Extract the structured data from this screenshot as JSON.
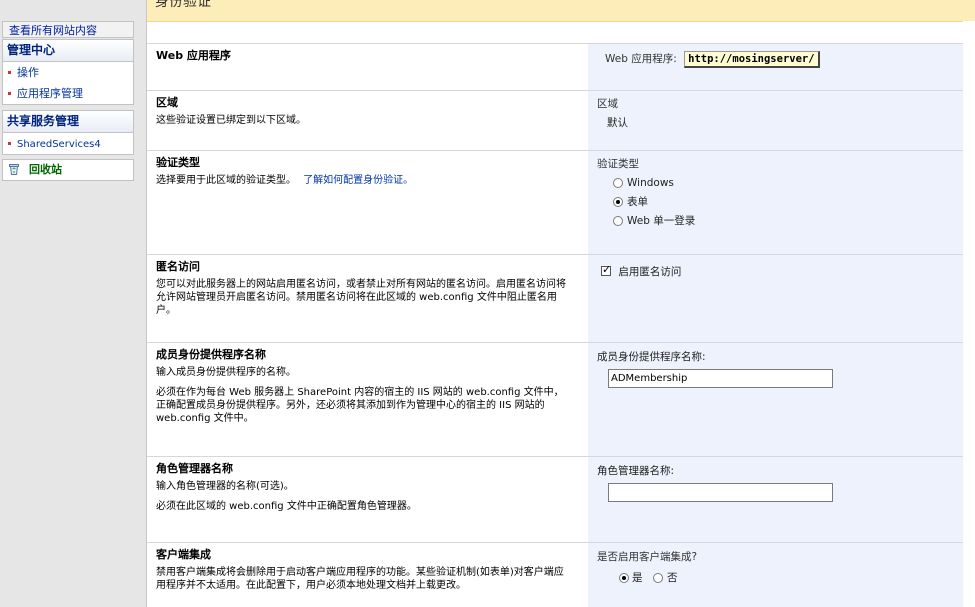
{
  "leftnav": {
    "view_all": "查看所有网站内容",
    "central_admin": {
      "heading": "管理中心",
      "items": [
        {
          "label": "操作"
        },
        {
          "label": "应用程序管理"
        }
      ]
    },
    "ssp": {
      "heading": "共享服务管理",
      "items": [
        {
          "label": "SharedServices4"
        }
      ]
    },
    "recycle_bin": "回收站"
  },
  "header": {
    "title_fragment": "身份验证"
  },
  "sections": {
    "web_app": {
      "title": "Web 应用程序",
      "control_label": "Web 应用程序:",
      "url": "http://mosingserver/"
    },
    "zone": {
      "title": "区域",
      "desc": "这些验证设置已绑定到以下区域。",
      "control_label": "区域",
      "value": "默认"
    },
    "auth_type": {
      "title": "验证类型",
      "desc": "选择要用于此区域的验证类型。",
      "link": "了解如何配置身份验证。",
      "control_label": "验证类型",
      "options": [
        {
          "label": "Windows",
          "selected": false
        },
        {
          "label": "表单",
          "selected": true
        },
        {
          "label": "Web 单一登录",
          "selected": false
        }
      ]
    },
    "anonymous": {
      "title": "匿名访问",
      "desc1": "您可以对此服务器上的网站启用匿名访问，或者禁止对所有网站的匿名访问。启用匿名访问将允许网站管理员开启匿名访问。禁用匿名访问将在此区域的 web.config 文件中阻止匿名用户。",
      "checkbox_label": "启用匿名访问",
      "checked": true
    },
    "membership": {
      "title": "成员身份提供程序名称",
      "desc1": "输入成员身份提供程序的名称。",
      "desc2": "必须在作为每台 Web 服务器上 SharePoint 内容的宿主的 IIS 网站的 web.config 文件中，正确配置成员身份提供程序。另外，还必须将其添加到作为管理中心的宿主的 IIS 网站的 web.config 文件中。",
      "control_label": "成员身份提供程序名称:",
      "value": "ADMembership"
    },
    "role_manager": {
      "title": "角色管理器名称",
      "desc1": "输入角色管理器的名称(可选)。",
      "desc2": "必须在此区域的 web.config 文件中正确配置角色管理器。",
      "control_label": "角色管理器名称:",
      "value": ""
    },
    "client_integration": {
      "title": "客户端集成",
      "desc1": "禁用客户端集成将会删除用于启动客户端应用程序的功能。某些验证机制(如表单)对客户端应用程序并不太适用。在此配置下，用户必须本地处理文档并上载更改。",
      "control_label": "是否启用客户端集成?",
      "options": [
        {
          "label": "是",
          "selected": true
        },
        {
          "label": "否",
          "selected": false
        }
      ]
    }
  }
}
